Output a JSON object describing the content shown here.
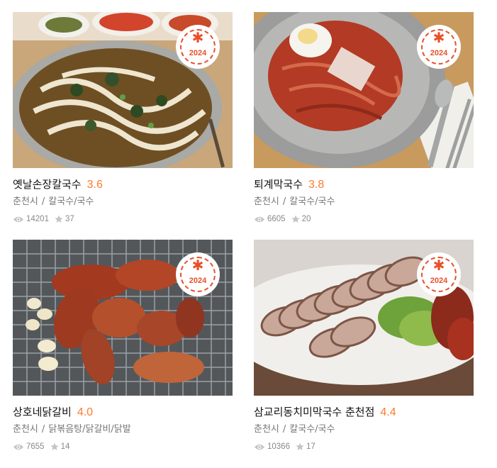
{
  "restaurants": [
    {
      "name": "옛날손장칼국수",
      "score": "3.6",
      "region": "춘천시",
      "category": "칼국수/국수",
      "views": "14201",
      "reviews": "37",
      "badge_year": "2024",
      "photo": "noodle-soup"
    },
    {
      "name": "퇴계막국수",
      "score": "3.8",
      "region": "춘천시",
      "category": "칼국수/국수",
      "views": "6605",
      "reviews": "20",
      "badge_year": "2024",
      "photo": "spicy-buckwheat-noodles"
    },
    {
      "name": "상호네닭갈비",
      "score": "4.0",
      "region": "춘천시",
      "category": "닭볶음탕/닭갈비/닭발",
      "views": "7655",
      "reviews": "14",
      "badge_year": "2024",
      "photo": "grilled-chicken"
    },
    {
      "name": "삼교리동치미막국수 춘천점",
      "score": "4.4",
      "region": "춘천시",
      "category": "칼국수/국수",
      "views": "10366",
      "reviews": "17",
      "badge_year": "2024",
      "photo": "sliced-pork"
    }
  ],
  "separator": "/",
  "icons": {
    "views": "eye-icon",
    "reviews": "star-icon",
    "badge": "asterisk-icon"
  },
  "colors": {
    "score": "#ff792a",
    "badge": "#e8502a"
  }
}
